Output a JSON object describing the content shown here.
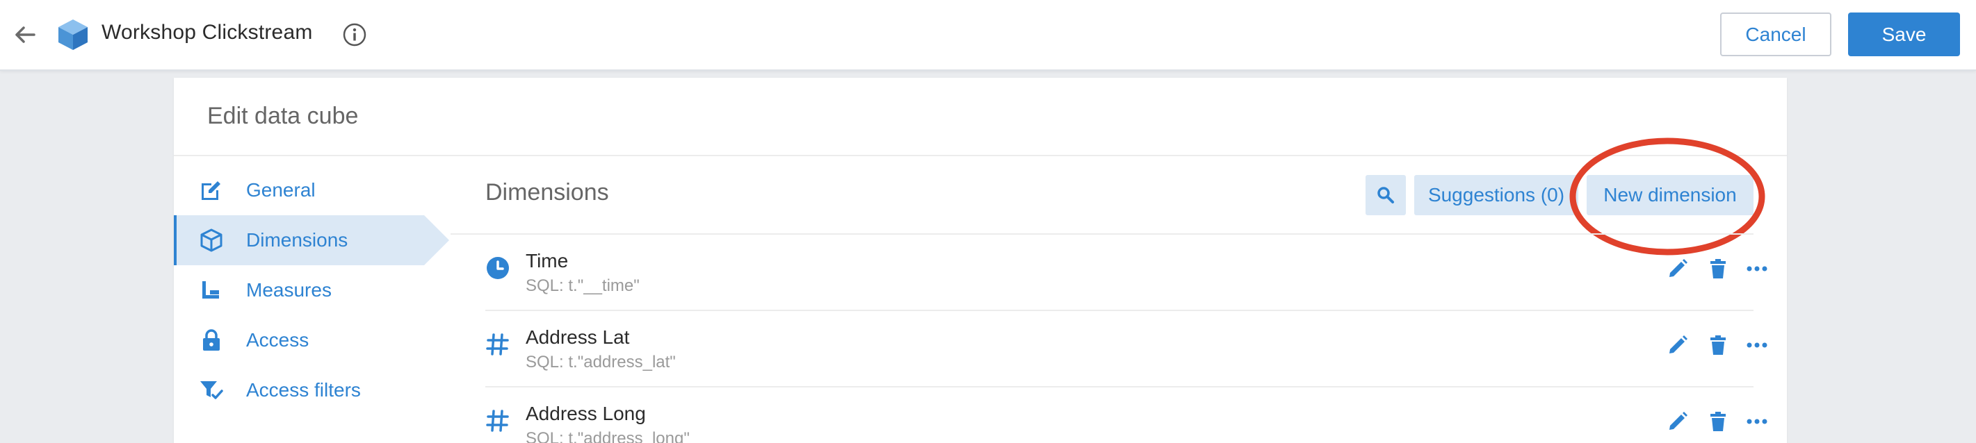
{
  "topbar": {
    "title": "Workshop Clickstream",
    "cancel_label": "Cancel",
    "save_label": "Save",
    "back_icon": "arrow-left-icon",
    "app_icon": "cube-icon",
    "info_icon": "info-icon"
  },
  "panel": {
    "title": "Edit data cube"
  },
  "sidebar": {
    "items": [
      {
        "label": "General",
        "icon": "edit-icon",
        "active": false
      },
      {
        "label": "Dimensions",
        "icon": "cube-outline-icon",
        "active": true
      },
      {
        "label": "Measures",
        "icon": "measures-icon",
        "active": false
      },
      {
        "label": "Access",
        "icon": "lock-icon",
        "active": false
      },
      {
        "label": "Access filters",
        "icon": "filter-check-icon",
        "active": false
      }
    ]
  },
  "content": {
    "title": "Dimensions",
    "search_icon": "search-icon",
    "suggestions_label": "Suggestions (0)",
    "new_dimension_label": "New dimension",
    "rows": [
      {
        "name": "Time",
        "sql": "SQL: t.\"__time\"",
        "type_icon": "clock-icon"
      },
      {
        "name": "Address Lat",
        "sql": "SQL: t.\"address_lat\"",
        "type_icon": "hash-icon"
      },
      {
        "name": "Address Long",
        "sql": "SQL: t.\"address_long\"",
        "type_icon": "hash-icon"
      }
    ]
  },
  "colors": {
    "accent": "#2e83d2",
    "accent_light": "#dbe8f5",
    "highlight": "#e0412b",
    "background": "#eaecef"
  }
}
